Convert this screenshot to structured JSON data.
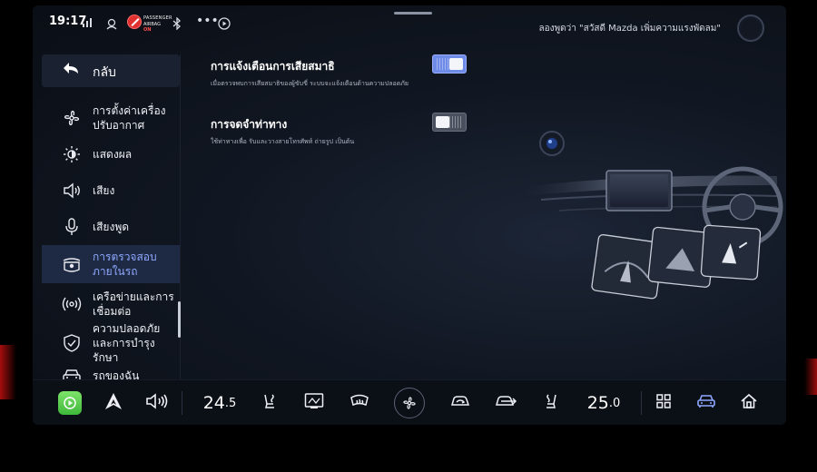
{
  "status": {
    "time": "19:17",
    "airbag_line1": "PASSENGER",
    "airbag_line2": "AIRBAG",
    "airbag_state": "ON",
    "voice_hint": "ลองพูดว่า \"สวัสดี Mazda เพิ่มความแรงพัดลม\""
  },
  "sidebar": {
    "back_label": "กลับ",
    "items": [
      {
        "label": "การตั้งค่าเครื่องปรับอากาศ",
        "icon": "fan-icon"
      },
      {
        "label": "แสดงผล",
        "icon": "brightness-icon"
      },
      {
        "label": "เสียง",
        "icon": "speaker-icon"
      },
      {
        "label": "เสียงพูด",
        "icon": "microphone-icon"
      },
      {
        "label": "การตรวจสอบภายในรถ",
        "icon": "cabin-camera-icon",
        "active": true
      },
      {
        "label": "เครือข่ายและการเชื่อมต่อ",
        "icon": "wireless-icon"
      },
      {
        "label": "ความปลอดภัยและการบำรุงรักษา",
        "icon": "shield-icon"
      },
      {
        "label": "รถของฉัน",
        "icon": "car-icon"
      }
    ]
  },
  "settings": [
    {
      "title": "การแจ้งเตือนการเสียสมาธิ",
      "desc": "เมื่อตรวจพบการเสียสมาธิของผู้ขับขี่ ระบบจะแจ้งเตือนด้านความปลอดภัย",
      "enabled": true
    },
    {
      "title": "การจดจำท่าทาง",
      "desc": "ใช้ท่าทางเพื่อ รับและวางสายโทรศัพท์ ถ่ายรูป เป็นต้น",
      "enabled": false
    }
  ],
  "dock": {
    "temp_left_int": "24",
    "temp_left_dec": ".5",
    "temp_right_int": "25",
    "temp_right_dec": ".0"
  },
  "colors": {
    "accent": "#8fa8ff",
    "toggle_on": "#6e8be8",
    "active_row": "#1e2a44"
  }
}
